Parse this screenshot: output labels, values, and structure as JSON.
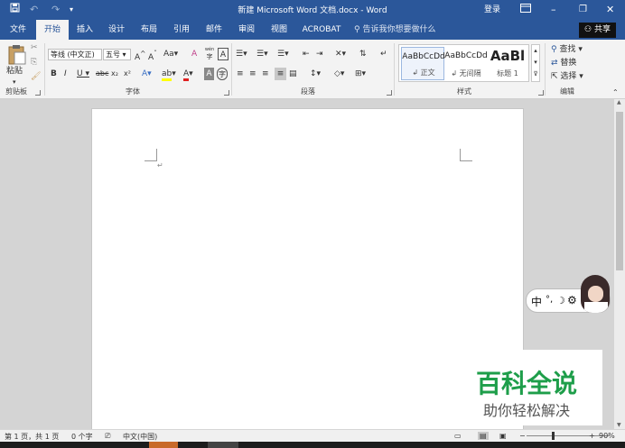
{
  "title_bar": {
    "title": "新建 Microsoft Word 文档.docx  -  Word",
    "login": "登录",
    "qat_save_icon": "save-icon",
    "qat_undo_icon": "undo-icon",
    "qat_redo_icon": "redo-icon"
  },
  "tabs": [
    "文件",
    "开始",
    "插入",
    "设计",
    "布局",
    "引用",
    "邮件",
    "审阅",
    "视图",
    "ACROBAT"
  ],
  "active_tab": "开始",
  "tell_me": "告诉我你想要做什么",
  "share": "共享",
  "clipboard": {
    "paste": "粘贴",
    "label": "剪贴板"
  },
  "font": {
    "name": "等线 (中文正)",
    "size": "五号",
    "label": "字体",
    "phonetic_char": "wén",
    "enclosed_char": "字"
  },
  "paragraph": {
    "label": "段落"
  },
  "styles": {
    "label": "样式",
    "items": [
      {
        "preview": "AaBbCcDd",
        "name": "正文",
        "selected": true
      },
      {
        "preview": "AaBbCcDd",
        "name": "无间隔",
        "selected": false
      },
      {
        "preview": "AaBl",
        "name": "标题 1",
        "selected": false
      }
    ]
  },
  "editing": {
    "find": "查找",
    "replace": "替换",
    "select": "选择",
    "label": "编辑"
  },
  "status": {
    "page": "第 1 页，共 1 页",
    "words": "0 个字",
    "language": "中文(中国)",
    "zoom": "90%"
  },
  "ime": {
    "mode": "中"
  },
  "watermark": {
    "title": "百科全说",
    "subtitle": "助你轻松解决"
  },
  "colors": {
    "accent": "#2b579a",
    "watermark_green": "#1e9e4a",
    "highlight": "#ffff00",
    "font_color": "#e02020"
  }
}
